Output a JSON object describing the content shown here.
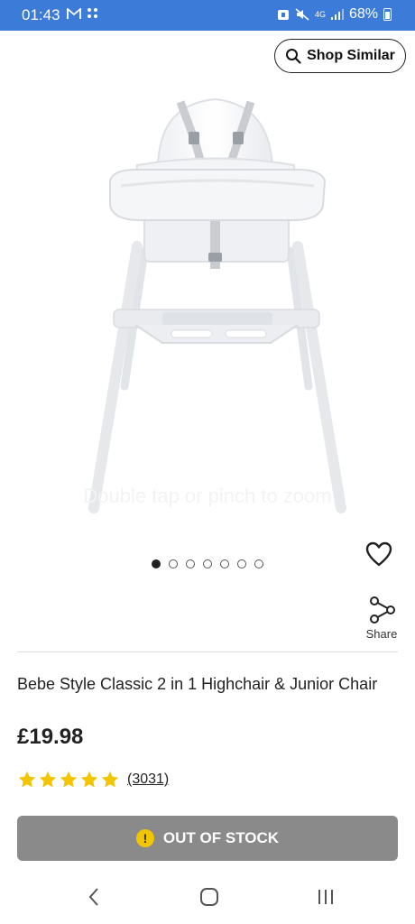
{
  "status_bar": {
    "time": "01:43",
    "battery_text": "68%",
    "network_text": "4G",
    "icons": [
      "gmail-icon",
      "apps-grid-icon",
      "alarm-icon",
      "mute-icon",
      "signal-icon",
      "battery-icon"
    ]
  },
  "header": {
    "shop_similar_label": "Shop Similar",
    "shop_similar_icon": "search-icon"
  },
  "gallery": {
    "zoom_hint": "Double tap or pinch to zoom",
    "total_images": 7,
    "active_index": 0
  },
  "actions": {
    "wishlist_icon": "heart-icon",
    "share_icon": "share-icon",
    "share_label": "Share"
  },
  "product": {
    "title": "Bebe Style Classic 2 in 1 Highchair & Junior Chair",
    "price": "£19.98",
    "rating": 5,
    "review_count": "(3031)"
  },
  "stock": {
    "label": "OUT OF STOCK",
    "icon": "warning-icon",
    "button_color": "#8a8a8a",
    "icon_color": "#f2c500"
  },
  "nav": {
    "items": [
      "back-icon",
      "home-icon",
      "recents-icon"
    ]
  },
  "colors": {
    "status_bar": "#3d7bd9",
    "star": "#f2c500"
  }
}
